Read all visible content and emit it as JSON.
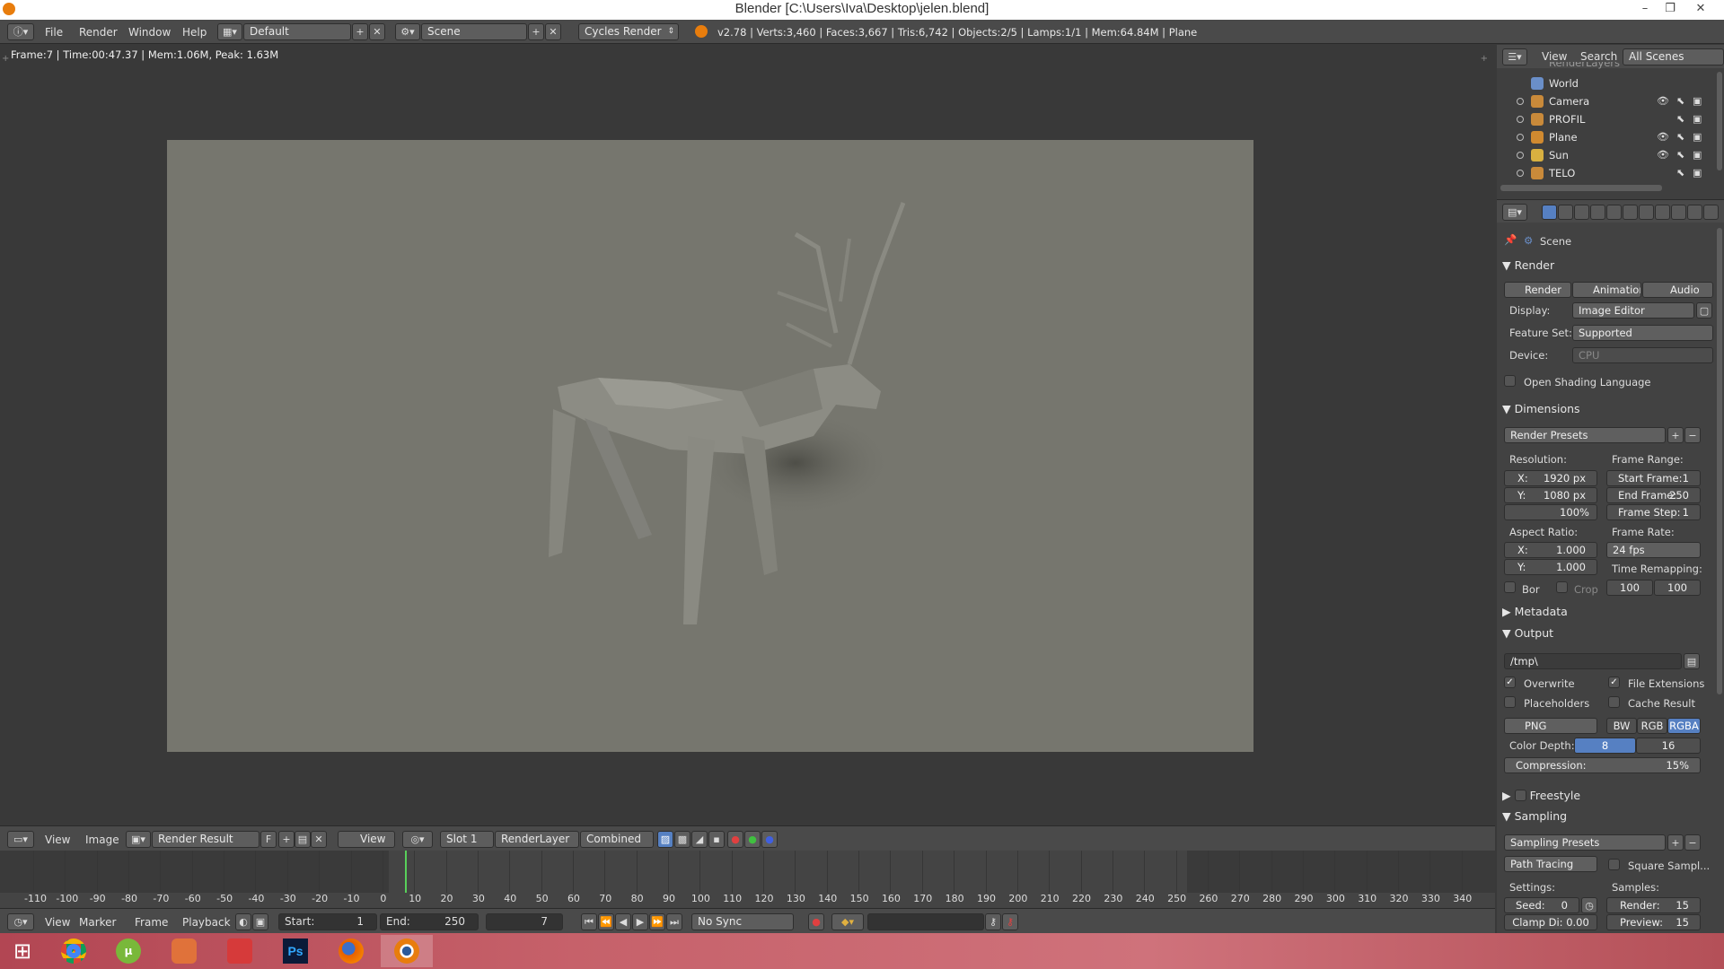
{
  "window": {
    "title": "Blender [C:\\Users\\Iva\\Desktop\\jelen.blend]",
    "minimize": "–",
    "maximize": "❐",
    "close": "✕"
  },
  "menu": {
    "items": [
      "File",
      "Render",
      "Window",
      "Help"
    ],
    "layout": "Default",
    "scene": "Scene",
    "engine": "Cycles Render",
    "stats": "v2.78 | Verts:3,460 | Faces:3,667 | Tris:6,742 | Objects:2/5 | Lamps:1/1 | Mem:64.84M | Plane"
  },
  "viewport": {
    "frame_info": "Frame:7 | Time:00:47.37 | Mem:1.06M, Peak: 1.63M"
  },
  "image_header": {
    "view": "View",
    "image": "Image",
    "image_name": "Render Result",
    "fake_user": "F",
    "view_select": "View",
    "slot": "Slot 1",
    "layer": "RenderLayer",
    "pass": "Combined"
  },
  "timeline": {
    "ticks": [
      "-110",
      "-100",
      "-90",
      "-80",
      "-70",
      "-60",
      "-50",
      "-40",
      "-30",
      "-20",
      "-10",
      "0",
      "10",
      "20",
      "30",
      "40",
      "50",
      "60",
      "70",
      "80",
      "90",
      "100",
      "110",
      "120",
      "130",
      "140",
      "150",
      "160",
      "170",
      "180",
      "190",
      "200",
      "210",
      "220",
      "230",
      "240",
      "250",
      "260",
      "270",
      "280",
      "290",
      "300",
      "310",
      "320",
      "330",
      "340"
    ],
    "current_frame": 7,
    "menus": [
      "View",
      "Marker",
      "Frame",
      "Playback"
    ],
    "start_label": "Start:",
    "start": "1",
    "end_label": "End:",
    "end": "250",
    "frame": "7",
    "sync": "No Sync"
  },
  "outliner": {
    "view": "View",
    "search": "Search",
    "filter": "All Scenes",
    "partial": "RenderLayers",
    "items": [
      {
        "name": "World",
        "icon": "world-icon",
        "color": "#6a8fc9"
      },
      {
        "name": "Camera",
        "icon": "camera-icon",
        "color": "#c98a3a"
      },
      {
        "name": "PROFIL",
        "icon": "armature-icon",
        "color": "#c98a3a"
      },
      {
        "name": "Plane",
        "icon": "mesh-icon",
        "color": "#d08a30"
      },
      {
        "name": "Sun",
        "icon": "lamp-icon",
        "color": "#d8b040"
      },
      {
        "name": "TELO",
        "icon": "armature-icon",
        "color": "#c98a3a"
      }
    ]
  },
  "properties": {
    "scene": "Scene",
    "render": {
      "title": "Render",
      "buttons": [
        "Render",
        "Animation",
        "Audio"
      ],
      "display_label": "Display:",
      "display": "Image Editor",
      "feature_label": "Feature Set:",
      "feature": "Supported",
      "device_label": "Device:",
      "device": "CPU",
      "osl": "Open Shading Language"
    },
    "dimensions": {
      "title": "Dimensions",
      "presets": "Render Presets",
      "resolution": "Resolution:",
      "res_x": "X:",
      "res_x_val": "1920 px",
      "res_y": "Y:",
      "res_y_val": "1080 px",
      "res_pct": "100%",
      "frame_range": "Frame Range:",
      "start_frame": "Start Frame:",
      "start_frame_val": "1",
      "end_frame": "End Frame:",
      "end_frame_val": "250",
      "frame_step": "Frame Step:",
      "frame_step_val": "1",
      "aspect": "Aspect Ratio:",
      "asp_x": "X:",
      "asp_x_val": "1.000",
      "asp_y": "Y:",
      "asp_y_val": "1.000",
      "frame_rate": "Frame Rate:",
      "fps": "24 fps",
      "time_remap": "Time Remapping:",
      "remap_old": "100",
      "remap_new": "100",
      "border": "Bor",
      "crop": "Crop"
    },
    "metadata": "Metadata",
    "output": {
      "title": "Output",
      "path": "/tmp\\",
      "overwrite": "Overwrite",
      "file_ext": "File Extensions",
      "placeholders": "Placeholders",
      "cache": "Cache Result",
      "format": "PNG",
      "bw": "BW",
      "rgb": "RGB",
      "rgba": "RGBA",
      "color_depth": "Color Depth:",
      "depth8": "8",
      "depth16": "16",
      "compression": "Compression:",
      "compression_val": "15%"
    },
    "freestyle": "Freestyle",
    "sampling": {
      "title": "Sampling",
      "presets": "Sampling Presets",
      "integrator": "Path Tracing",
      "square": "Square Sampl...",
      "settings": "Settings:",
      "samples": "Samples:",
      "seed": "Seed:",
      "seed_val": "0",
      "render": "Render:",
      "render_val": "15",
      "clamp": "Clamp Di: 0.00",
      "preview": "Preview:",
      "preview_val": "15"
    }
  },
  "colors": {
    "accent": "#5680c2",
    "panel": "#424242",
    "header": "#4a4a4a",
    "render_bg": "#76766e",
    "playhead": "#58d05a"
  }
}
